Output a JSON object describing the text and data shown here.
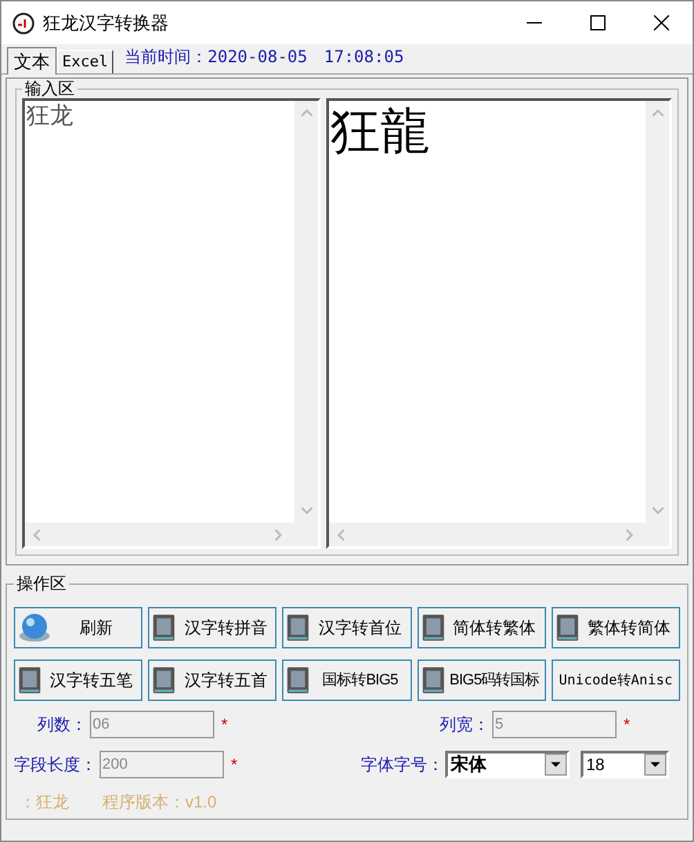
{
  "window": {
    "title": "狂龙汉字转换器"
  },
  "tabs": [
    {
      "label": "文本",
      "selected": true
    },
    {
      "label": "Excel",
      "selected": false
    }
  ],
  "current_time": "当前时间：2020-08-05　17:08:05",
  "input_group": {
    "title": "输入区",
    "source_text": "狂龙",
    "result_text": "狂龍"
  },
  "operation_group": {
    "title": "操作区",
    "buttons": [
      {
        "label": "刷新",
        "kind": "globe"
      },
      {
        "label": "汉字转拼音",
        "kind": "book"
      },
      {
        "label": "汉字转首位",
        "kind": "book"
      },
      {
        "label": "简体转繁体",
        "kind": "book"
      },
      {
        "label": "繁体转简体",
        "kind": "book"
      },
      {
        "label": "汉字转五笔",
        "kind": "book"
      },
      {
        "label": "汉字转五首",
        "kind": "book"
      },
      {
        "label": "国标转BIG5",
        "kind": "book"
      },
      {
        "label": "BIG5码转国标",
        "kind": "book"
      },
      {
        "label": "Unicode转Anisc",
        "kind": "plain"
      }
    ],
    "fields": [
      {
        "label": "列数：",
        "value": "06",
        "required": "*",
        "disabled": true
      },
      {
        "label": "列宽：",
        "value": "5",
        "required": "*",
        "disabled": true
      },
      {
        "label": "字段长度：",
        "value": "200",
        "required": "*",
        "disabled": true
      }
    ],
    "font_label": "字体字号：",
    "font_name": "宋体",
    "font_size": "18"
  },
  "footer": {
    "author": "：狂龙",
    "version": "程序版本：v1.0"
  }
}
